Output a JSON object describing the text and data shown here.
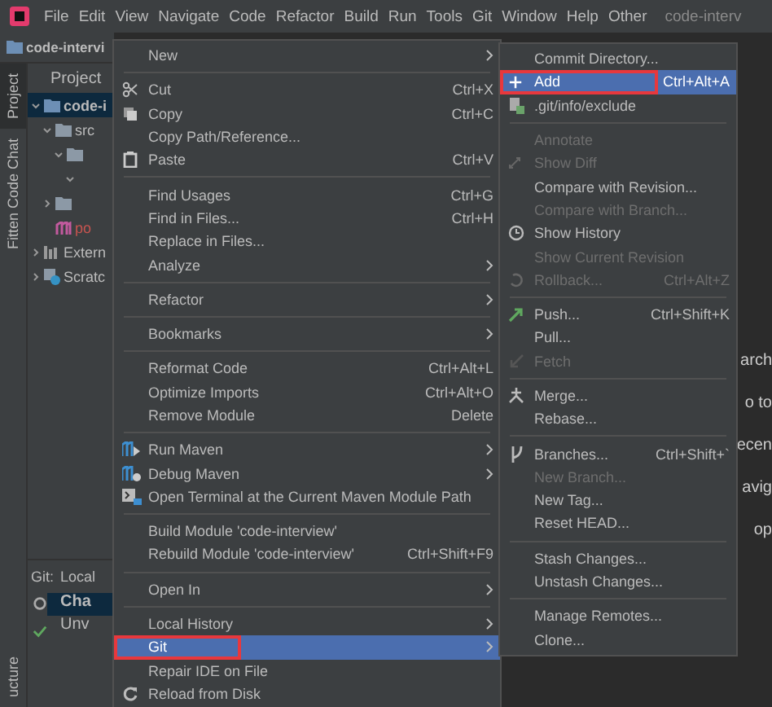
{
  "menu_bar": {
    "items": [
      "File",
      "Edit",
      "View",
      "Navigate",
      "Code",
      "Refactor",
      "Build",
      "Run",
      "Tools",
      "Git",
      "Window",
      "Help",
      "Other"
    ],
    "title": "code-interv"
  },
  "project_bar": {
    "name": "code-intervi"
  },
  "tool_strip": {
    "tabs": [
      {
        "label": "Project",
        "selected": true
      },
      {
        "label": "Fitten Code Chat",
        "selected": false
      }
    ],
    "bottom_label": "ucture"
  },
  "project_panel": {
    "header": "Project",
    "tree": [
      {
        "label": "code-i",
        "kind": "module",
        "selected": true,
        "collapsed": false,
        "children": [
          {
            "label": "src",
            "kind": "folder",
            "selected": false,
            "collapsed": false,
            "children": [
              {
                "kind": "folder",
                "selected": false,
                "collapsed": false,
                "children": [
                  {
                    "selected": false,
                    "collapsed": false
                  }
                ]
              }
            ]
          },
          {
            "kind": "folder",
            "selected": false,
            "collapsed": true
          },
          {
            "label": "po",
            "kind": "maven",
            "selected": false
          }
        ]
      },
      {
        "label": "Extern",
        "kind": "libs",
        "selected": false,
        "collapsed": true
      },
      {
        "label": "Scratc",
        "kind": "scratch",
        "selected": false,
        "collapsed": true
      }
    ]
  },
  "git_panel": {
    "label": "Git:",
    "tab": "Local",
    "items": [
      {
        "label": "Cha",
        "selected": true
      },
      {
        "label": "Unv",
        "selected": false
      }
    ]
  },
  "editor": {
    "fragments": [
      "arch",
      "o to",
      "ecen",
      "avig",
      "op"
    ]
  },
  "context_menu": {
    "items": [
      {
        "kind": "item",
        "label": "New",
        "submenu": true
      },
      {
        "kind": "separator"
      },
      {
        "kind": "scissors",
        "label": "Cut",
        "shortcut": "Ctrl+X"
      },
      {
        "kind": "copy",
        "label": "Copy",
        "shortcut": "Ctrl+C"
      },
      {
        "kind": "item",
        "label": "Copy Path/Reference..."
      },
      {
        "kind": "paste",
        "label": "Paste",
        "shortcut": "Ctrl+V"
      },
      {
        "kind": "separator"
      },
      {
        "kind": "item",
        "label": "Find Usages",
        "shortcut": "Ctrl+G"
      },
      {
        "kind": "item",
        "label": "Find in Files...",
        "shortcut": "Ctrl+H"
      },
      {
        "kind": "item",
        "label": "Replace in Files..."
      },
      {
        "kind": "item",
        "label": "Analyze",
        "submenu": true
      },
      {
        "kind": "separator"
      },
      {
        "kind": "item",
        "label": "Refactor",
        "submenu": true
      },
      {
        "kind": "separator"
      },
      {
        "kind": "item",
        "label": "Bookmarks",
        "submenu": true
      },
      {
        "kind": "separator"
      },
      {
        "kind": "item",
        "label": "Reformat Code",
        "shortcut": "Ctrl+Alt+L"
      },
      {
        "kind": "item",
        "label": "Optimize Imports",
        "shortcut": "Ctrl+Alt+O"
      },
      {
        "kind": "item",
        "label": "Remove Module",
        "shortcut": "Delete"
      },
      {
        "kind": "separator"
      },
      {
        "kind": "mavenrun",
        "label": "Run Maven",
        "submenu": true
      },
      {
        "kind": "mavendebug",
        "label": "Debug Maven",
        "submenu": true
      },
      {
        "kind": "terminal",
        "label": "Open Terminal at the Current Maven Module Path"
      },
      {
        "kind": "separator"
      },
      {
        "kind": "item",
        "label": "Build Module 'code-interview'"
      },
      {
        "kind": "item",
        "label": "Rebuild Module 'code-interview'",
        "shortcut": "Ctrl+Shift+F9"
      },
      {
        "kind": "separator"
      },
      {
        "kind": "item",
        "label": "Open In",
        "submenu": true
      },
      {
        "kind": "separator"
      },
      {
        "kind": "item",
        "label": "Local History",
        "submenu": true,
        "selected": false,
        "highlighted": false
      },
      {
        "kind": "item",
        "label": "Git",
        "submenu": true,
        "selected": true,
        "highlighted": true
      },
      {
        "kind": "item",
        "label": "Repair IDE on File"
      },
      {
        "kind": "reload",
        "label": "Reload from Disk"
      }
    ]
  },
  "git_submenu": {
    "items": [
      {
        "kind": "item",
        "label": "Commit Directory..."
      },
      {
        "kind": "plus",
        "label": "Add",
        "shortcut": "Ctrl+Alt+A",
        "selected": true,
        "highlighted": true
      },
      {
        "kind": "exclude",
        "label": ".git/info/exclude"
      },
      {
        "kind": "separator"
      },
      {
        "kind": "item",
        "label": "Annotate",
        "disabled": true
      },
      {
        "kind": "diff",
        "label": "Show Diff",
        "disabled": true
      },
      {
        "kind": "item",
        "label": "Compare with Revision...",
        "disabled": false
      },
      {
        "kind": "item",
        "label": "Compare with Branch...",
        "disabled": true
      },
      {
        "kind": "clock",
        "label": "Show History",
        "disabled": false
      },
      {
        "kind": "item",
        "label": "Show Current Revision",
        "disabled": true
      },
      {
        "kind": "rollback",
        "label": "Rollback...",
        "shortcut": "Ctrl+Alt+Z",
        "disabled": true
      },
      {
        "kind": "separator"
      },
      {
        "kind": "push",
        "label": "Push...",
        "shortcut": "Ctrl+Shift+K",
        "disabled": false
      },
      {
        "kind": "item",
        "label": "Pull...",
        "disabled": false
      },
      {
        "kind": "fetch",
        "label": "Fetch",
        "disabled": true
      },
      {
        "kind": "separator"
      },
      {
        "kind": "merge",
        "label": "Merge..."
      },
      {
        "kind": "item",
        "label": "Rebase..."
      },
      {
        "kind": "separator"
      },
      {
        "kind": "branch",
        "label": "Branches...",
        "shortcut": "Ctrl+Shift+`",
        "disabled": false
      },
      {
        "kind": "item",
        "label": "New Branch...",
        "disabled": true
      },
      {
        "kind": "item",
        "label": "New Tag...",
        "disabled": false
      },
      {
        "kind": "item",
        "label": "Reset HEAD..."
      },
      {
        "kind": "separator"
      },
      {
        "kind": "item",
        "label": "Stash Changes..."
      },
      {
        "kind": "item",
        "label": "Unstash Changes..."
      },
      {
        "kind": "separator"
      },
      {
        "kind": "item",
        "label": "Manage Remotes..."
      },
      {
        "kind": "item",
        "label": "Clone..."
      }
    ]
  }
}
